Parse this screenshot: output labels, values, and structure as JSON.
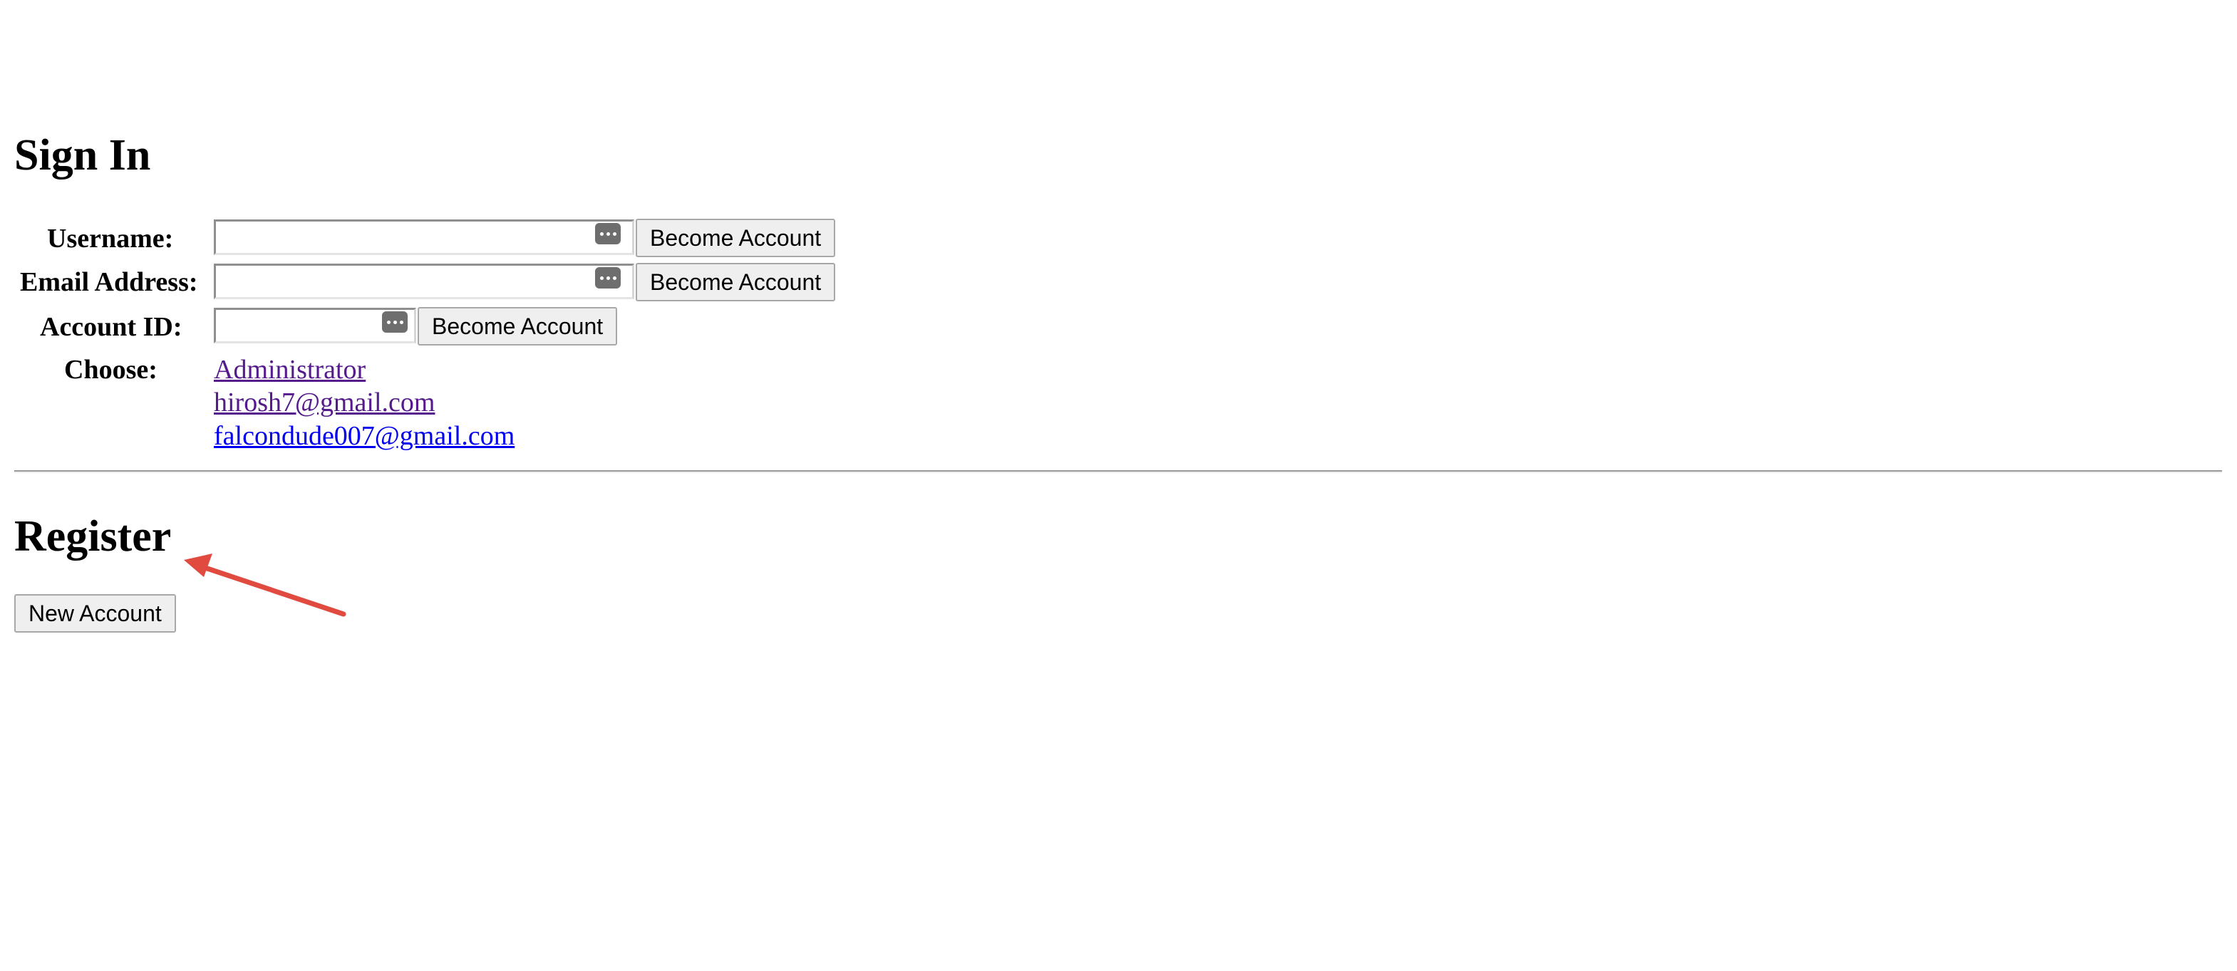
{
  "signin": {
    "title": "Sign In",
    "username_label": "Username:",
    "email_label": "Email Address:",
    "account_id_label": "Account ID:",
    "choose_label": "Choose:",
    "become_label": "Become Account",
    "username_value": "",
    "email_value": "",
    "account_id_value": "",
    "accounts": [
      {
        "label": "Administrator",
        "visited": true
      },
      {
        "label": "hirosh7@gmail.com",
        "visited": true
      },
      {
        "label": "falcondude007@gmail.com",
        "visited": false
      }
    ]
  },
  "register": {
    "title": "Register",
    "new_account_label": "New Account"
  },
  "colors": {
    "link_visited": "#551a8b",
    "link_unvisited": "#0000ee",
    "annotation_arrow": "#e04a3f"
  },
  "icons": {
    "field_autofill": "password-dots-icon",
    "annotation": "arrow-annotation"
  }
}
